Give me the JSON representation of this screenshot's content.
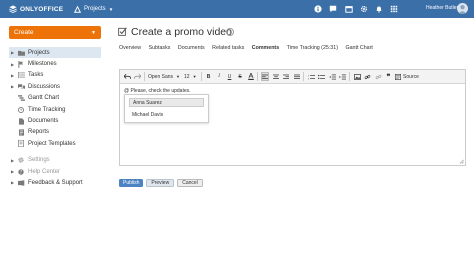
{
  "topbar": {
    "brand": "ONLYOFFICE",
    "module": "Projects",
    "user_name": "Heather Butler",
    "icons": [
      "info-icon",
      "chat-icon",
      "calendar-icon",
      "gear-icon",
      "bell-icon",
      "grid-icon"
    ],
    "background": "#3a6fa8"
  },
  "sidebar": {
    "create_label": "Create",
    "create_color": "#ed7309",
    "items": [
      {
        "label": "Projects",
        "icon": "folder-icon",
        "active": true
      },
      {
        "label": "Milestones",
        "icon": "milestone-icon",
        "active": false
      },
      {
        "label": "Tasks",
        "icon": "tasks-icon",
        "active": false
      },
      {
        "label": "Discussions",
        "icon": "discussions-icon",
        "active": false
      },
      {
        "label": "Gantt Chart",
        "icon": "gantt-icon",
        "active": false
      },
      {
        "label": "Time Tracking",
        "icon": "clock-icon",
        "active": false
      },
      {
        "label": "Documents",
        "icon": "documents-icon",
        "active": false
      },
      {
        "label": "Reports",
        "icon": "reports-icon",
        "active": false
      },
      {
        "label": "Project Templates",
        "icon": "templates-icon",
        "active": false
      }
    ],
    "bottom_items": [
      {
        "label": "Settings",
        "icon": "gear-icon"
      },
      {
        "label": "Help Center",
        "icon": "help-icon"
      },
      {
        "label": "Feedback & Support",
        "icon": "feedback-icon"
      }
    ]
  },
  "main": {
    "title": "Create a promo video",
    "tabs": [
      "Overview",
      "Subtasks",
      "Documents",
      "Related tasks",
      "Comments",
      "Time Tracking (25:31)",
      "Gantt Chart"
    ],
    "active_tab": "Comments",
    "editor": {
      "font_name": "Open Sans",
      "font_size": "12",
      "source_label": "Source",
      "content": "@ Please, check the updates.",
      "mention_options": [
        "Anna Suarez",
        "Michael Davis"
      ],
      "highlighted_option": "Anna Suarez"
    },
    "buttons": {
      "publish": "Publish",
      "preview": "Preview",
      "cancel": "Cancel"
    }
  }
}
